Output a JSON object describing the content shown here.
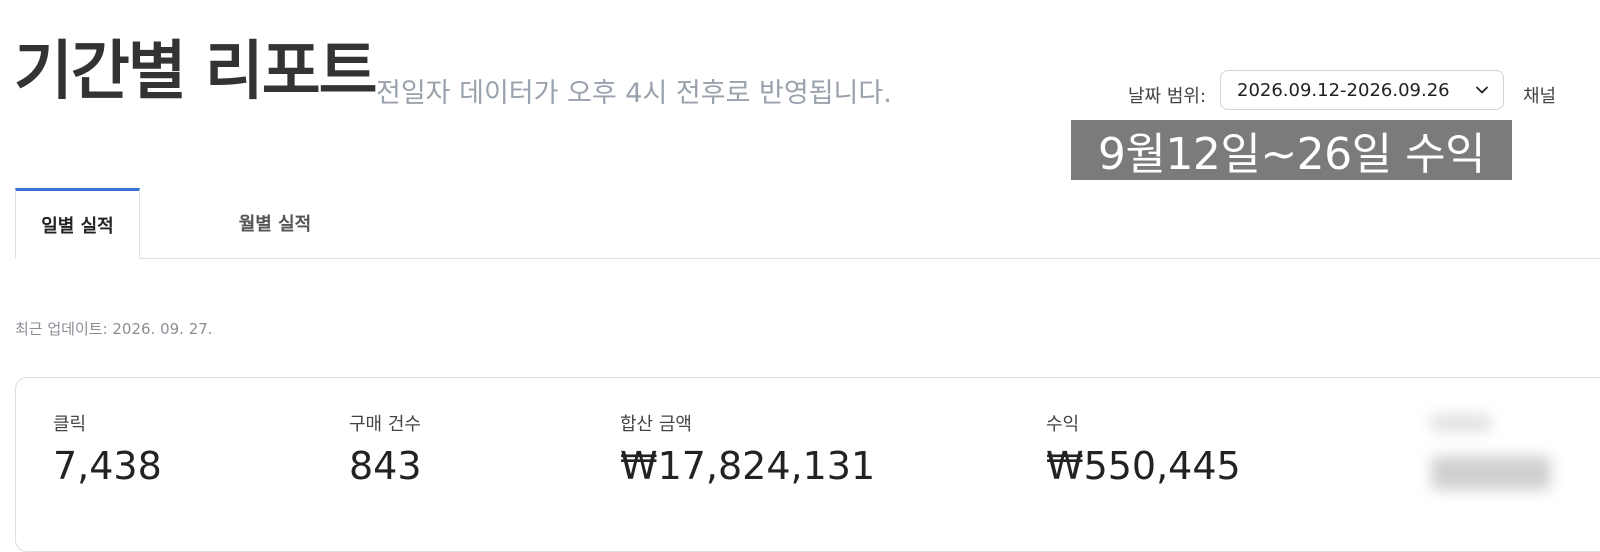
{
  "header": {
    "title": "기간별 리포트",
    "subtitle": "전일자 데이터가 오후 4시 전후로 반영됩니다."
  },
  "filters": {
    "date_range_label": "날짜 범위:",
    "date_range_value": "2026.09.12-2026.09.26",
    "channel_label": "채널 "
  },
  "annotation": {
    "text": "9월12일~26일 수익"
  },
  "tabs": [
    {
      "label": "일별 실적",
      "active": true
    },
    {
      "label": "월별 실적",
      "active": false
    }
  ],
  "last_updated": "최근 업데이트: 2026. 09. 27.",
  "stats": {
    "clicks": {
      "label": "클릭",
      "value": "7,438"
    },
    "purchases": {
      "label": "구매 건수",
      "value": "843"
    },
    "total_amount": {
      "label": "합산 금액",
      "value": "₩17,824,131"
    },
    "revenue": {
      "label": "수익",
      "value": "₩550,445"
    }
  },
  "colors": {
    "accent": "#3b73d6",
    "annotation_bg": "#7b7b7b",
    "subtitle": "#9aa2ad"
  }
}
